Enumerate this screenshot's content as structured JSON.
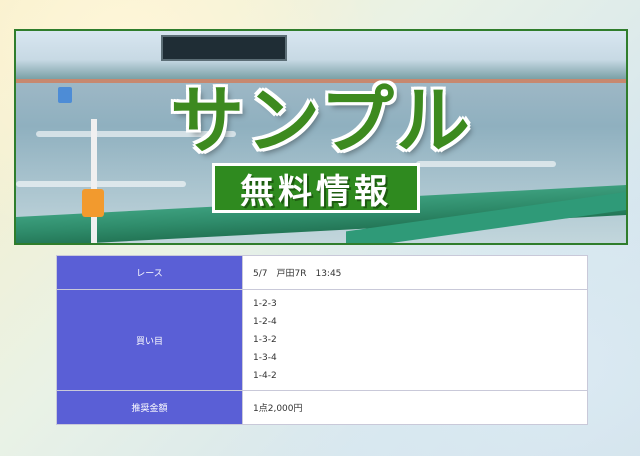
{
  "banner": {
    "title": "サンプル",
    "badge": "無料情報"
  },
  "table": {
    "rows": [
      {
        "label": "レース",
        "value": "5/7　戸田7R　13:45"
      },
      {
        "label": "買い目",
        "values": [
          "1-2-3",
          "1-2-4",
          "1-3-2",
          "1-3-4",
          "1-4-2"
        ]
      },
      {
        "label": "推奨金額",
        "value": "1点2,000円"
      }
    ]
  },
  "colors": {
    "header_bg": "#5a5fd6",
    "banner_green": "#3d8a1f",
    "amount_red": "#d23a2a"
  }
}
